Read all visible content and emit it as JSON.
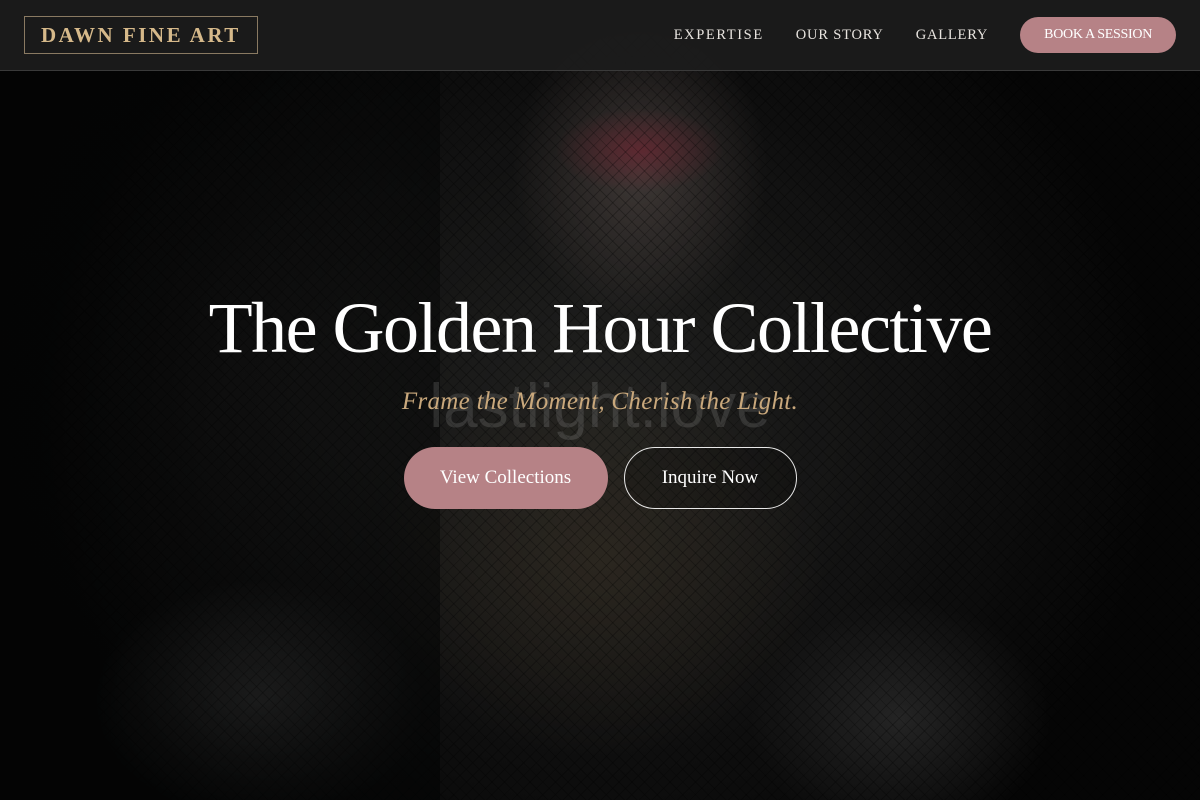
{
  "header": {
    "logo": "DAWN FINE ART",
    "nav": [
      {
        "label": "EXPERTISE"
      },
      {
        "label": "OUR STORY"
      },
      {
        "label": "GALLERY"
      }
    ],
    "cta": "BOOK A SESSION"
  },
  "hero": {
    "title": "The Golden Hour Collective",
    "tagline": "Frame the Moment, Cherish the Light.",
    "watermark": "lastlight.love",
    "primary_button": "View Collections",
    "secondary_button": "Inquire Now"
  },
  "colors": {
    "accent": "#b68286",
    "gold": "#c9a87c",
    "logo_gold": "#d6b98a",
    "header_bg": "#1c1c1c"
  }
}
